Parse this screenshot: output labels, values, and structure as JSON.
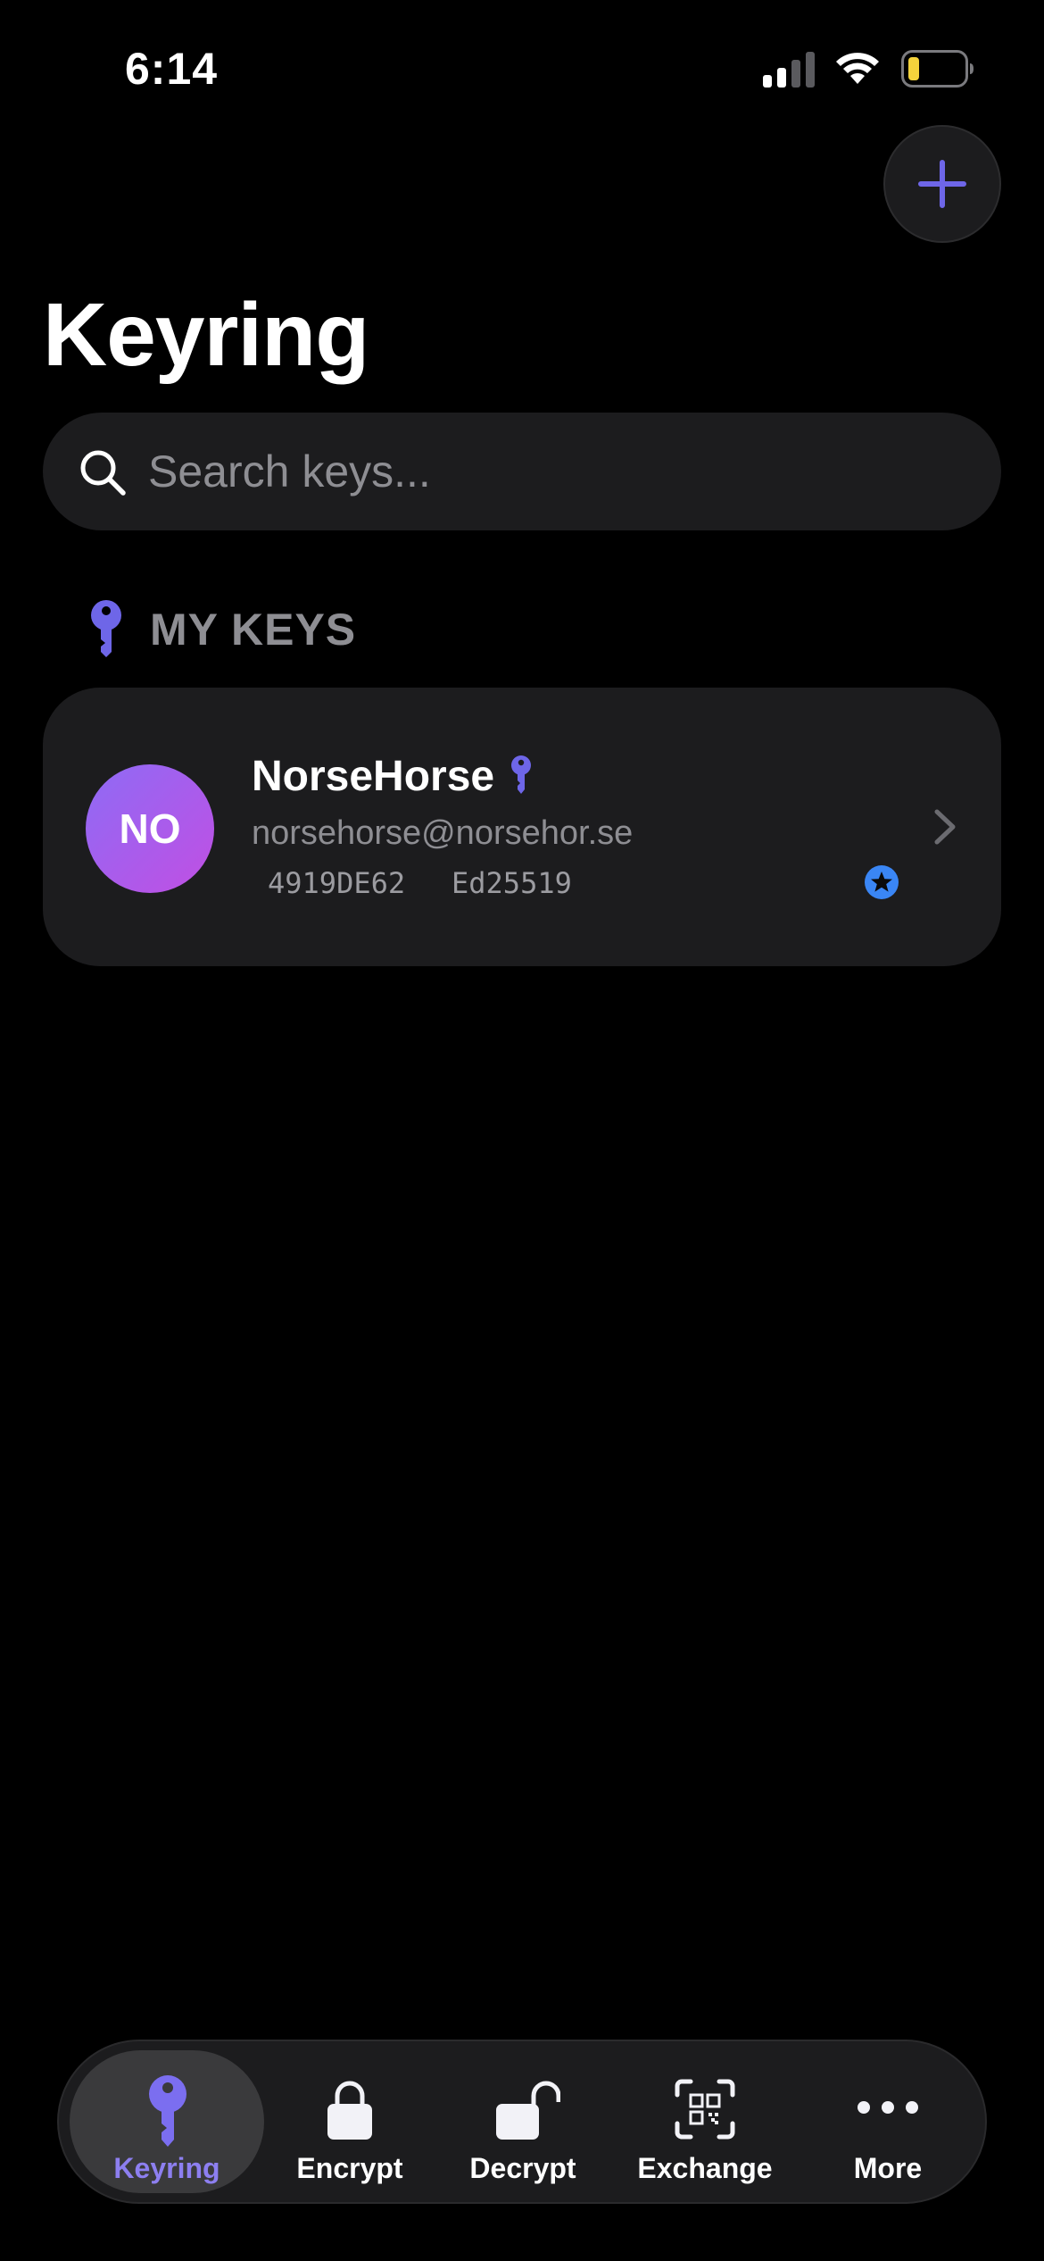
{
  "status_bar": {
    "time": "6:14"
  },
  "header": {
    "title": "Keyring"
  },
  "search": {
    "placeholder": "Search keys..."
  },
  "section": {
    "label": "MY KEYS"
  },
  "key": {
    "initials": "NO",
    "name": "NorseHorse",
    "email": "norsehorse@norsehor.se",
    "key_id": "4919DE62",
    "algorithm": "Ed25519"
  },
  "tabs": [
    {
      "label": "Keyring",
      "icon": "key-icon",
      "active": true
    },
    {
      "label": "Encrypt",
      "icon": "lock-icon",
      "active": false
    },
    {
      "label": "Decrypt",
      "icon": "unlock-icon",
      "active": false
    },
    {
      "label": "Exchange",
      "icon": "qr-scan-icon",
      "active": false
    },
    {
      "label": "More",
      "icon": "ellipsis-icon",
      "active": false
    }
  ],
  "colors": {
    "accent": "#6e66e8",
    "active_tab_label": "#8d7ff0",
    "avatar_gradient_start": "#8e6bf5",
    "avatar_gradient_end": "#c14fe3",
    "badge_blue": "#3a86f5"
  }
}
